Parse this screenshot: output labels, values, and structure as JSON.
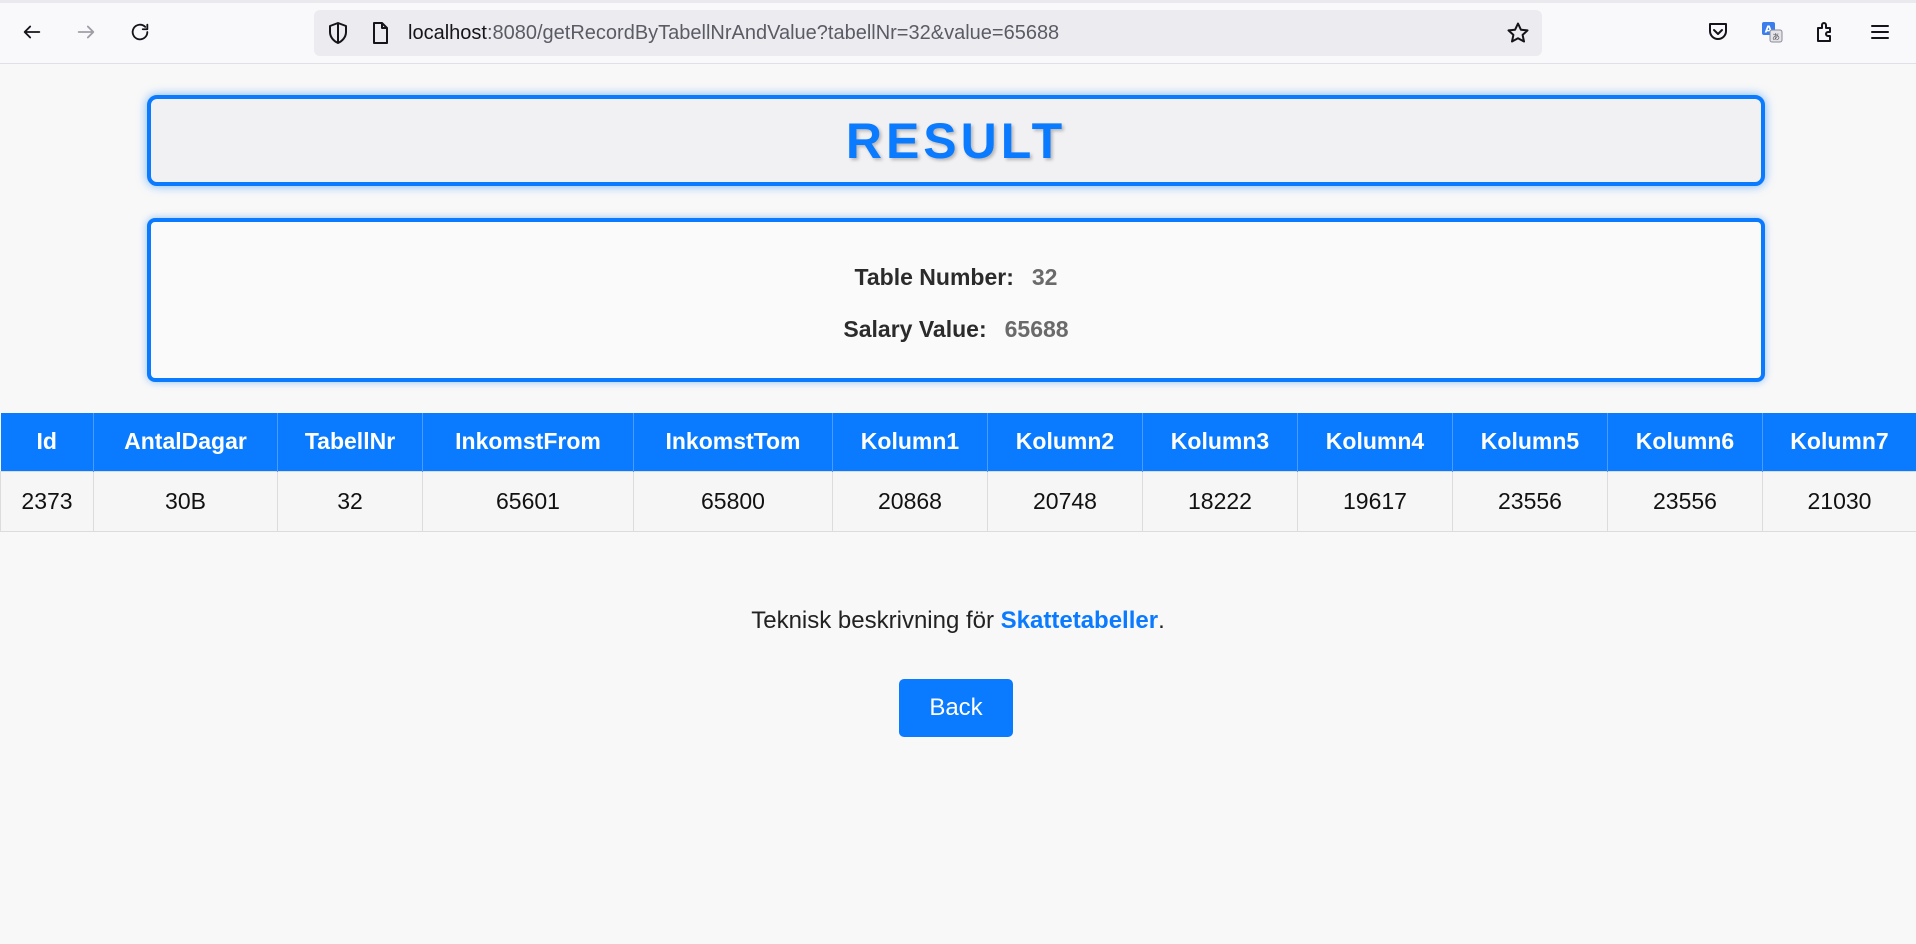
{
  "browser": {
    "url_host": "localhost",
    "url_rest": ":8080/getRecordByTabellNrAndValue?tabellNr=32&value=65688",
    "icons": [
      "back-arrow-icon",
      "forward-arrow-icon",
      "reload-icon",
      "shield-icon",
      "page-icon",
      "star-icon",
      "pocket-icon",
      "translate-icon",
      "extensions-icon",
      "menu-icon"
    ]
  },
  "page": {
    "title": "RESULT",
    "table_number_label": "Table Number:",
    "table_number_value": "32",
    "salary_label": "Salary Value:",
    "salary_value": "65688",
    "description_prefix": "Teknisk beskrivning för ",
    "description_link": "Skattetabeller",
    "description_suffix": ".",
    "back_label": "Back",
    "accent_color": "#0a7bff"
  },
  "table": {
    "headers": [
      "Id",
      "AntalDagar",
      "TabellNr",
      "InkomstFrom",
      "InkomstTom",
      "Kolumn1",
      "Kolumn2",
      "Kolumn3",
      "Kolumn4",
      "Kolumn5",
      "Kolumn6",
      "Kolumn7"
    ],
    "rows": [
      [
        "2373",
        "30B",
        "32",
        "65601",
        "65800",
        "20868",
        "20748",
        "18222",
        "19617",
        "23556",
        "23556",
        "21030"
      ]
    ]
  }
}
